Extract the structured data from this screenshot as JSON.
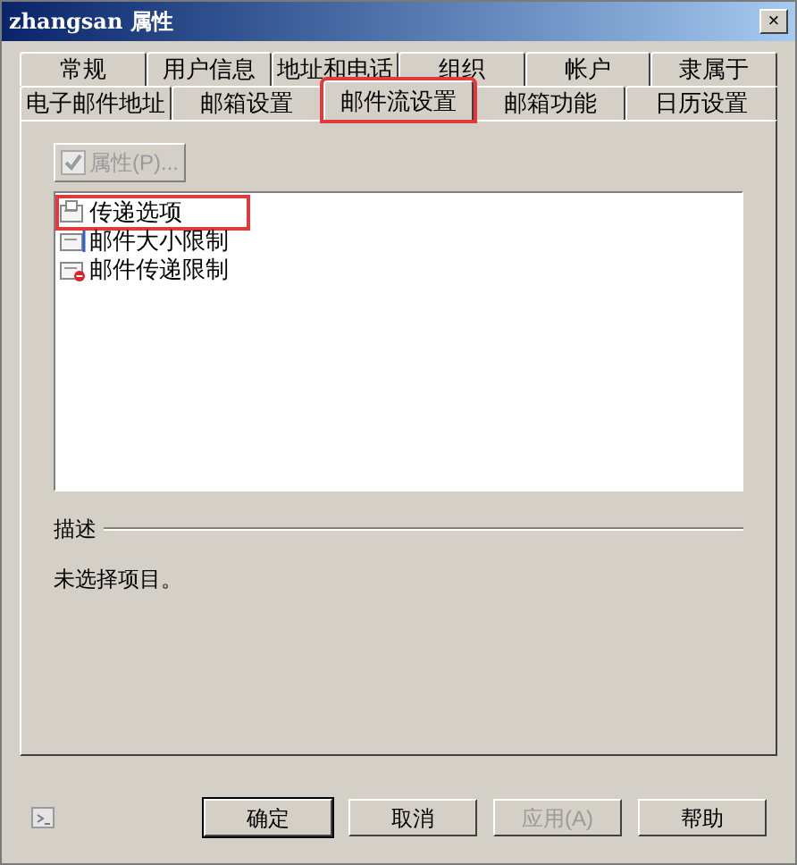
{
  "window": {
    "title": "zhangsan 属性",
    "close": "×"
  },
  "tab_rows": [
    [
      {
        "label": "常规",
        "selected": false,
        "highlighted": false
      },
      {
        "label": "用户信息",
        "selected": false,
        "highlighted": false
      },
      {
        "label": "地址和电话",
        "selected": false,
        "highlighted": false
      },
      {
        "label": "组织",
        "selected": false,
        "highlighted": false
      },
      {
        "label": "帐户",
        "selected": false,
        "highlighted": false
      },
      {
        "label": "隶属于",
        "selected": false,
        "highlighted": false
      }
    ],
    [
      {
        "label": "电子邮件地址",
        "selected": false,
        "highlighted": false
      },
      {
        "label": "邮箱设置",
        "selected": false,
        "highlighted": false
      },
      {
        "label": "邮件流设置",
        "selected": true,
        "highlighted": true
      },
      {
        "label": "邮箱功能",
        "selected": false,
        "highlighted": false
      },
      {
        "label": "日历设置",
        "selected": false,
        "highlighted": false
      }
    ]
  ],
  "properties_button": {
    "label": "属性(P)...",
    "disabled": true
  },
  "items": [
    {
      "label": "传递选项",
      "kind": "delivery",
      "highlighted": true
    },
    {
      "label": "邮件大小限制",
      "kind": "size",
      "highlighted": false
    },
    {
      "label": "邮件传递限制",
      "kind": "restriction",
      "highlighted": false
    }
  ],
  "description": {
    "heading": "描述",
    "text": "未选择项目。"
  },
  "buttons": [
    {
      "label": "确定",
      "disabled": false,
      "default": true
    },
    {
      "label": "取消",
      "disabled": false,
      "default": false
    },
    {
      "label": "应用(A)",
      "disabled": true,
      "default": false
    },
    {
      "label": "帮助",
      "disabled": false,
      "default": false
    }
  ]
}
